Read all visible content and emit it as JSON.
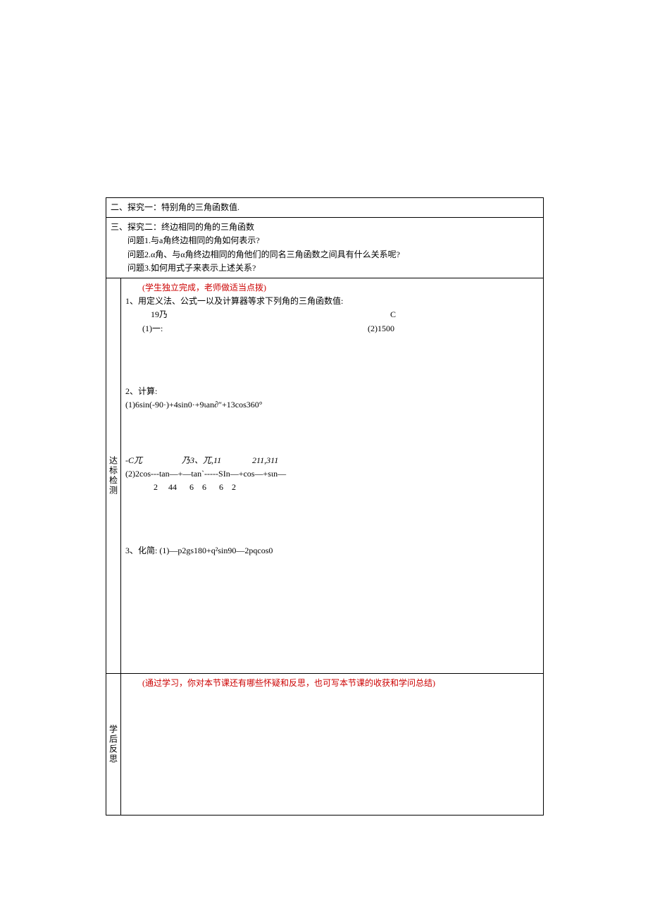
{
  "section2": {
    "title": "二、探究一：特别角的三角函数值."
  },
  "section3": {
    "title": "三、探究二：终边相同的角的三角函数",
    "q1": "问题1.与a角终边相同的角如何表示?",
    "q2": "问题2.α角、与α角终边相同的角他们的同名三角函数之间具有什么关系呢?",
    "q3": "问题3.如何用式子来表示上述关系?"
  },
  "dabiao": {
    "side": "达标检测",
    "note": "(学生独立完成，老师做适当点拨)",
    "p1_title": "1、用定义法、公式一以及计算器等求下列角的三角函数值:",
    "p1_line1a": "19乃",
    "p1_line1b": "C",
    "p1_sub1": "(1)一:",
    "p1_sub2": "(2)1500",
    "p2_title": "2、计算:",
    "p2_eq1": "(1)6sin(-90·)+4sin0·+9ιan∂″+13cos360°",
    "p2_eq2_l1a": "-C兀",
    "p2_eq2_l1b": "乃3、兀,11",
    "p2_eq2_l1c": "211,311",
    "p2_eq2_l2": "(2)2cos---tan—+—tan`-----SIn—+cos—+sιn—",
    "p2_eq2_l3": "2     44      6    6      6    2",
    "p3_title": "3、化简:  (1)—p2gs180+q²sin90—2pqcos0"
  },
  "xuehou": {
    "side": "学后反思",
    "note": "(通过学习，你对本节课还有哪些怀疑和反思，也可写本节课的收获和学问总结)"
  }
}
